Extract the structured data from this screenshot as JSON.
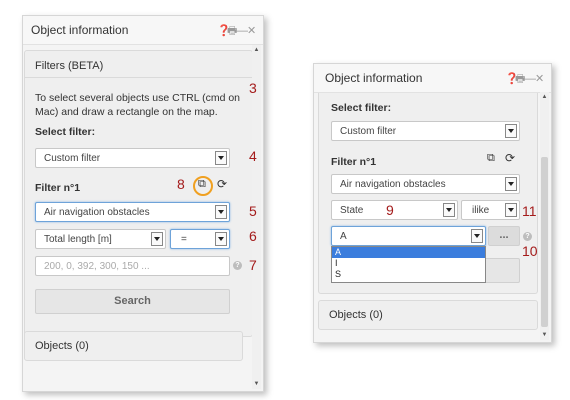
{
  "left_panel": {
    "title": "Object information",
    "header_icons": [
      "help-icon",
      "print-icon",
      "minimize-icon",
      "close-icon"
    ],
    "filters_section_title": "Filters (BETA)",
    "instructions": "To select several objects use CTRL (cmd on Mac) and draw a rectangle on the map.",
    "select_filter_label": "Select filter:",
    "filter_select_value": "Custom filter",
    "filter_heading": "Filter n°1",
    "layer_select_value": "Air navigation obstacles",
    "attribute_select_value": "Total length [m]",
    "operator_select_value": "=",
    "value_input_placeholder": "200, 0, 392, 300, 150 ...",
    "search_button_label": "Search",
    "objects_section_title": "Objects (0)"
  },
  "right_panel": {
    "title": "Object information",
    "select_filter_label": "Select filter:",
    "filter_select_value": "Custom filter",
    "filter_heading": "Filter n°1",
    "layer_select_value": "Air navigation obstacles",
    "attribute_select_value": "State",
    "operator_select_value": "ilike",
    "value_select_value": "A",
    "more_button_label": "...",
    "dropdown_options": [
      "A",
      "I",
      "S"
    ],
    "dropdown_selected": "A",
    "objects_section_title": "Objects (0)"
  },
  "callouts": {
    "n3": "3",
    "n4": "4",
    "n5": "5",
    "n6": "6",
    "n7": "7",
    "n8": "8",
    "n9": "9",
    "n10": "10",
    "n11": "11"
  },
  "colors": {
    "callout": "#a41b1b",
    "highlight_ring": "#f0a020",
    "selection": "#3b7ddd"
  }
}
